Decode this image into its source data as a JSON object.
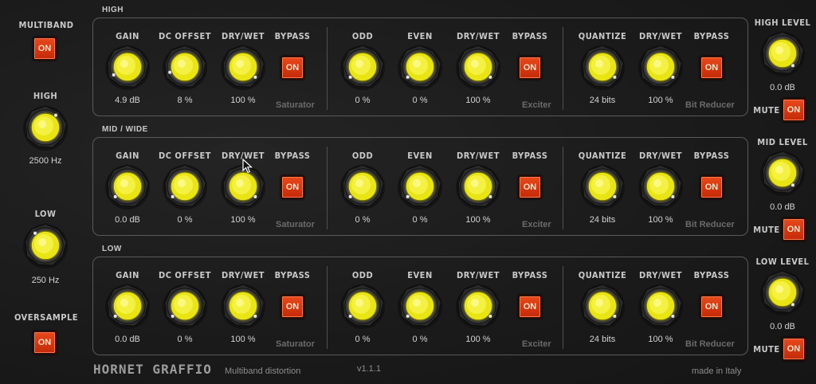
{
  "global": {
    "multiband_label": "MULTIBAND",
    "multiband_button": "ON",
    "high_label": "HIGH",
    "high_value": "2500 Hz",
    "low_label": "LOW",
    "low_value": "250 Hz",
    "oversample_label": "OVERSAMPLE",
    "oversample_button": "ON"
  },
  "bands": [
    {
      "title": "HIGH",
      "saturator": {
        "gain_label": "GAIN",
        "gain_value": "4.9 dB",
        "dc_label": "DC OFFSET",
        "dc_value": "8 %",
        "drywet_label": "DRY/WET",
        "drywet_value": "100 %",
        "bypass_label": "BYPASS",
        "bypass_button": "ON",
        "name": "Saturator"
      },
      "exciter": {
        "odd_label": "ODD",
        "odd_value": "0 %",
        "even_label": "EVEN",
        "even_value": "0 %",
        "drywet_label": "DRY/WET",
        "drywet_value": "100 %",
        "bypass_label": "BYPASS",
        "bypass_button": "ON",
        "name": "Exciter"
      },
      "bitreducer": {
        "quantize_label": "QUANTIZE",
        "quantize_value": "24 bits",
        "drywet_label": "DRY/WET",
        "drywet_value": "100 %",
        "bypass_label": "BYPASS",
        "bypass_button": "ON",
        "name": "Bit Reducer"
      },
      "level_label": "HIGH LEVEL",
      "level_value": "0.0 dB",
      "mute_label": "MUTE",
      "mute_button": "ON"
    },
    {
      "title": "MID / WIDE",
      "saturator": {
        "gain_label": "GAIN",
        "gain_value": "0.0 dB",
        "dc_label": "DC OFFSET",
        "dc_value": "0 %",
        "drywet_label": "DRY/WET",
        "drywet_value": "100 %",
        "bypass_label": "BYPASS",
        "bypass_button": "ON",
        "name": "Saturator"
      },
      "exciter": {
        "odd_label": "ODD",
        "odd_value": "0 %",
        "even_label": "EVEN",
        "even_value": "0 %",
        "drywet_label": "DRY/WET",
        "drywet_value": "100 %",
        "bypass_label": "BYPASS",
        "bypass_button": "ON",
        "name": "Exciter"
      },
      "bitreducer": {
        "quantize_label": "QUANTIZE",
        "quantize_value": "24 bits",
        "drywet_label": "DRY/WET",
        "drywet_value": "100 %",
        "bypass_label": "BYPASS",
        "bypass_button": "ON",
        "name": "Bit Reducer"
      },
      "level_label": "MID LEVEL",
      "level_value": "0.0 dB",
      "mute_label": "MUTE",
      "mute_button": "ON"
    },
    {
      "title": "LOW",
      "saturator": {
        "gain_label": "GAIN",
        "gain_value": "0.0 dB",
        "dc_label": "DC OFFSET",
        "dc_value": "0 %",
        "drywet_label": "DRY/WET",
        "drywet_value": "100 %",
        "bypass_label": "BYPASS",
        "bypass_button": "ON",
        "name": "Saturator"
      },
      "exciter": {
        "odd_label": "ODD",
        "odd_value": "0 %",
        "even_label": "EVEN",
        "even_value": "0 %",
        "drywet_label": "DRY/WET",
        "drywet_value": "100 %",
        "bypass_label": "BYPASS",
        "bypass_button": "ON",
        "name": "Exciter"
      },
      "bitreducer": {
        "quantize_label": "QUANTIZE",
        "quantize_value": "24 bits",
        "drywet_label": "DRY/WET",
        "drywet_value": "100 %",
        "bypass_label": "BYPASS",
        "bypass_button": "ON",
        "name": "Bit Reducer"
      },
      "level_label": "LOW LEVEL",
      "level_value": "0.0 dB",
      "mute_label": "MUTE",
      "mute_button": "ON"
    }
  ],
  "footer": {
    "brand": "HORNET GRAFFIO",
    "subtitle": "Multiband distortion",
    "version": "v1.1.1",
    "made_in": "made in Italy"
  },
  "colors": {
    "knob_yellow": "#f2ee1a",
    "button_red": "#d9380f",
    "panel_border": "#5a5a5a"
  },
  "icons": {
    "knob": "rotary-knob-icon",
    "pointer": "mouse-pointer-icon"
  }
}
